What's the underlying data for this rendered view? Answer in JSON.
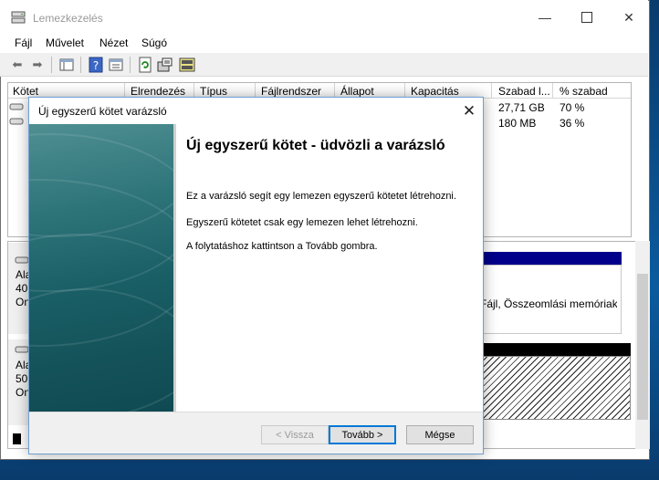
{
  "window": {
    "title": "Lemezkezelés"
  },
  "menu": [
    "Fájl",
    "Művelet",
    "Nézet",
    "Súgó"
  ],
  "toolbar": {
    "icons": [
      "back-arrow-icon",
      "forward-arrow-icon",
      "console-tree-icon",
      "help-icon",
      "properties-icon",
      "refresh-icon",
      "settings-icon",
      "disk-icon"
    ]
  },
  "volume_table": {
    "columns": [
      "Kötet",
      "Elrendezés",
      "Típus",
      "Fájlrendszer",
      "Állapot",
      "Kapacitás",
      "Szabad l...",
      "% szabad"
    ],
    "rows": [
      {
        "free": "27,71 GB",
        "pct": "70 %"
      },
      {
        "free": "180 MB",
        "pct": "36 %"
      }
    ]
  },
  "disk_pane": {
    "disk0": {
      "lines": [
        "Ala",
        "40,",
        "On"
      ],
      "partition_text": "Fájl, Összeomlási memóriak"
    },
    "disk1": {
      "lines": [
        "Ala",
        "50,",
        "On"
      ]
    }
  },
  "dialog": {
    "title": "Új egyszerű kötet varázsló",
    "heading": "Új egyszerű kötet - üdvözli a varázsló",
    "para1": "Ez a varázsló segít egy lemezen egyszerű kötetet létrehozni.",
    "para2": "Egyszerű kötetet csak egy lemezen lehet létrehozni.",
    "para3": "A folytatáshoz kattintson a Tovább gombra.",
    "buttons": {
      "back": "< Vissza",
      "next": "Tovább >",
      "cancel": "Mégse"
    }
  },
  "colors": {
    "accent": "#0078d7",
    "primary_partition": "#00008b",
    "unallocated": "#000000"
  }
}
